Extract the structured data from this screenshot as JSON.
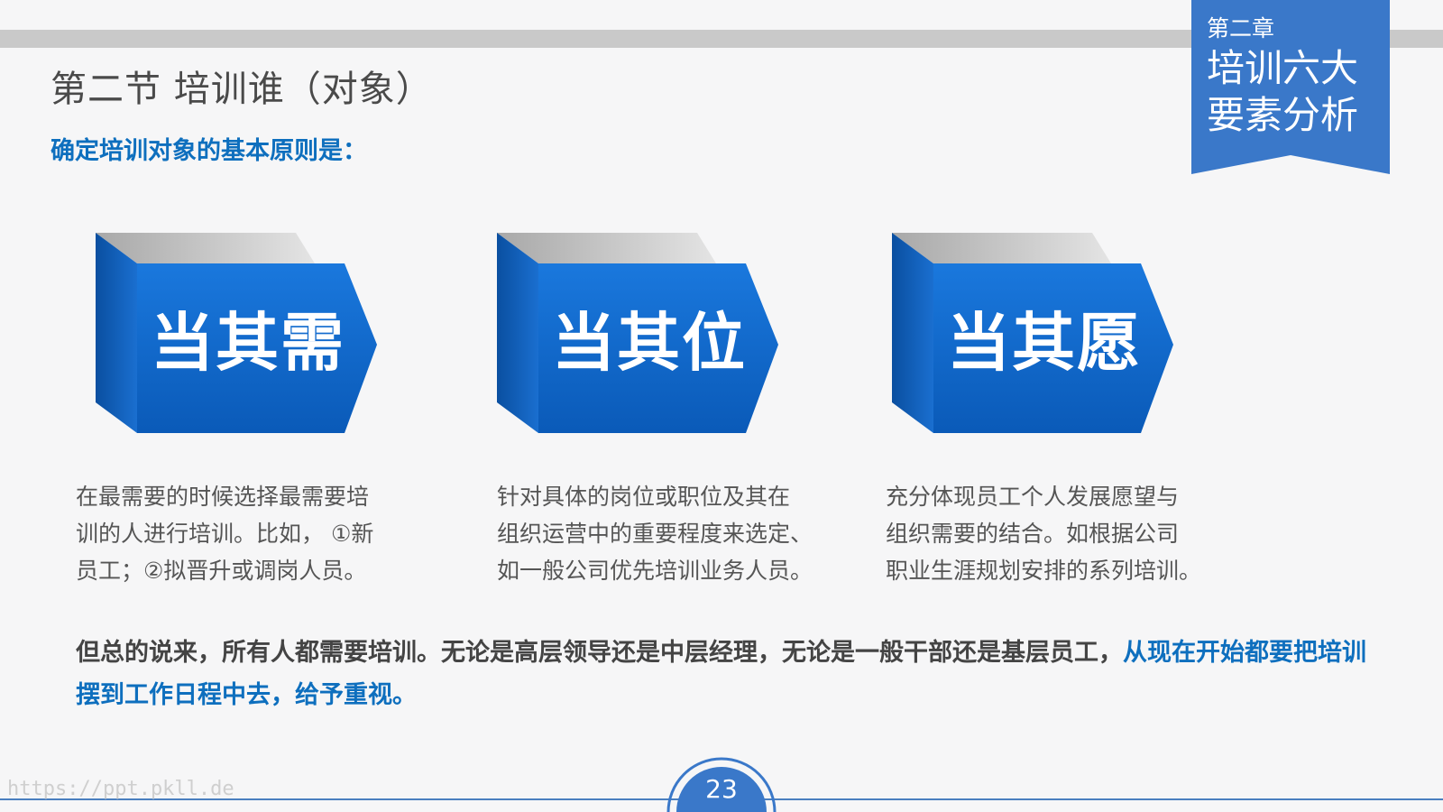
{
  "header": {
    "section_title": "第二节  培训谁（对象）",
    "principle_heading": "确定培训对象的基本原则是："
  },
  "chapter": {
    "label": "第二章",
    "title": "培训六大要素分析"
  },
  "cards": [
    {
      "label": "当其需",
      "description": [
        "在最需要的时候选择最需要培",
        "训的人进行培训。比如， ①新",
        "员工；②拟晋升或调岗人员。"
      ]
    },
    {
      "label": "当其位",
      "description": [
        "针对具体的岗位或职位及其在",
        "组织运营中的重要程度来选定、",
        "如一般公司优先培训业务人员。"
      ]
    },
    {
      "label": "当其愿",
      "description": [
        "充分体现员工个人发展愿望与",
        "组织需要的结合。如根据公司",
        "职业生涯规划安排的系列培训。"
      ]
    }
  ],
  "summary": {
    "normal_text": "但总的说来，所有人都需要培训。无论是高层领导还是中层经理，无论是一般干部还是基层员工，",
    "highlight_text": "从现在开始都要把培训摆到工作日程中去，给予重视。"
  },
  "footer": {
    "page_number": "23",
    "watermark": "https://ppt.pkll.de"
  },
  "colors": {
    "accent_blue": "#0e6fbe",
    "ribbon_blue": "#3a78c9",
    "arrow_blue": "#1167c9",
    "text_gray": "#555555"
  }
}
